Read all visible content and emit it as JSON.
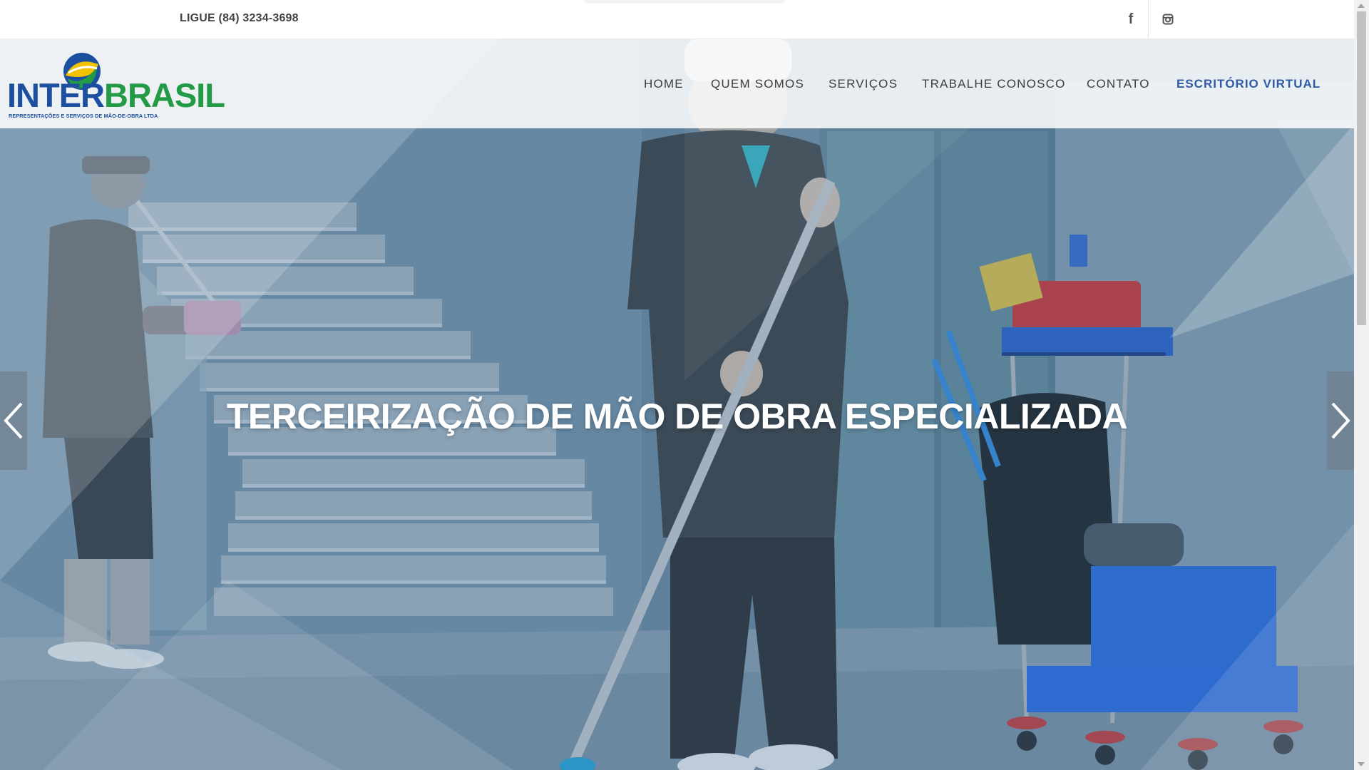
{
  "topbar": {
    "phone": "LIGUE (84) 3234-3698",
    "social": [
      "facebook-icon",
      "instagram-icon"
    ]
  },
  "logo": {
    "name_part1": "INTER",
    "name_part2": "BRASIL",
    "tagline": "REPRESENTAÇÕES E SERVIÇOS DE MÃO-DE-OBRA LTDA",
    "colors": {
      "blue": "#1d4fa0",
      "green": "#239b46",
      "yellow": "#f2c200"
    }
  },
  "nav": {
    "items": [
      {
        "label": "HOME"
      },
      {
        "label": "QUEM SOMOS"
      },
      {
        "label": "SERVIÇOS"
      },
      {
        "label": "TRABALHE CONOSCO"
      },
      {
        "label": "CONTATO"
      },
      {
        "label": "ESCRITÓRIO VIRTUAL",
        "active": true
      }
    ],
    "accent_color": "#2f5aa8"
  },
  "hero": {
    "title": "TERCEIRIZAÇÃO DE MÃO DE OBRA ESPECIALIZADA",
    "prev_icon": "chevron-left-icon",
    "next_icon": "chevron-right-icon"
  }
}
